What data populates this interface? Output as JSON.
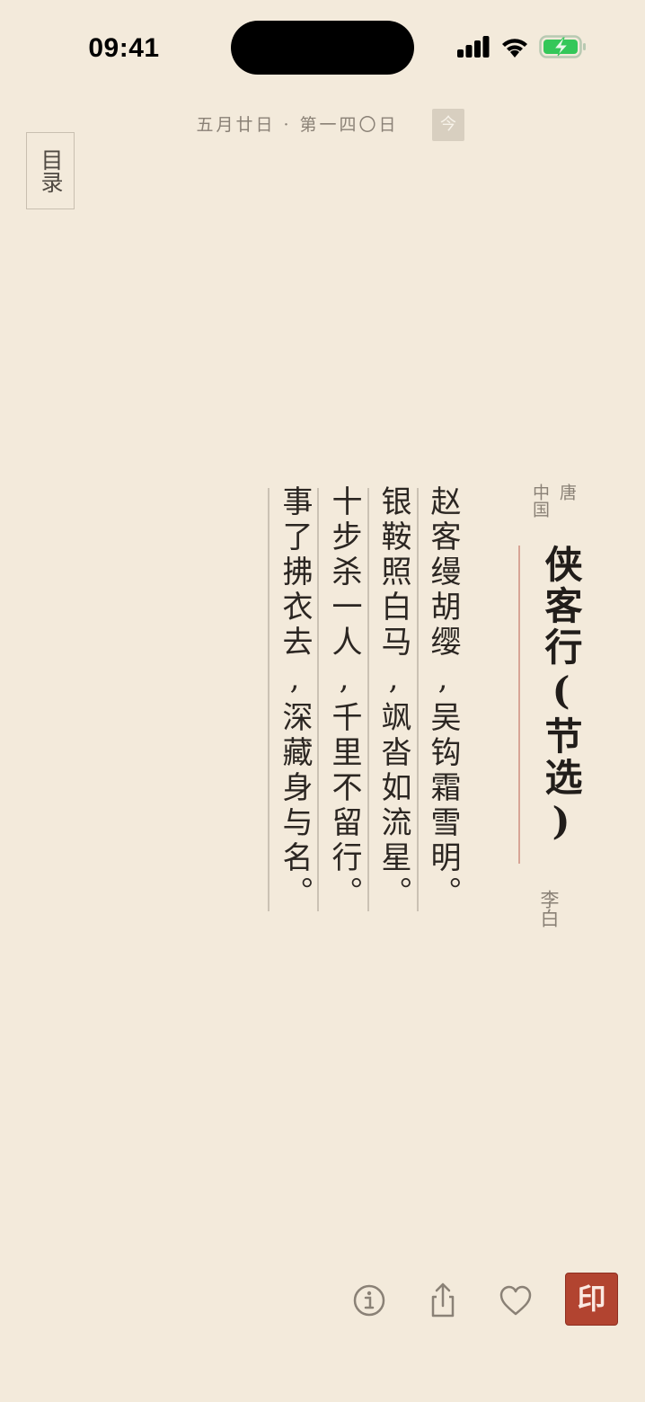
{
  "status_bar": {
    "time": "09:41",
    "icons": [
      "cellular-signal-icon",
      "wifi-icon",
      "battery-charging-icon"
    ],
    "battery_color": "#34c759"
  },
  "header": {
    "date_text": "五月廿日 · 第一四〇日",
    "today_label": "今"
  },
  "catalog": {
    "label": "目录"
  },
  "poem": {
    "dynasty": "唐 中国",
    "title": "侠客行(节选)",
    "author": "李白",
    "lines": [
      "赵客缦胡缨,吴钩霜雪明。",
      "银鞍照白马,飒沓如流星。",
      "十步杀一人,千里不留行。",
      "事了拂衣去,深藏身与名。"
    ]
  },
  "toolbar": {
    "icons": [
      "info-icon",
      "share-icon",
      "heart-icon"
    ],
    "seal_label": "印",
    "seal_color": "#b24430"
  }
}
